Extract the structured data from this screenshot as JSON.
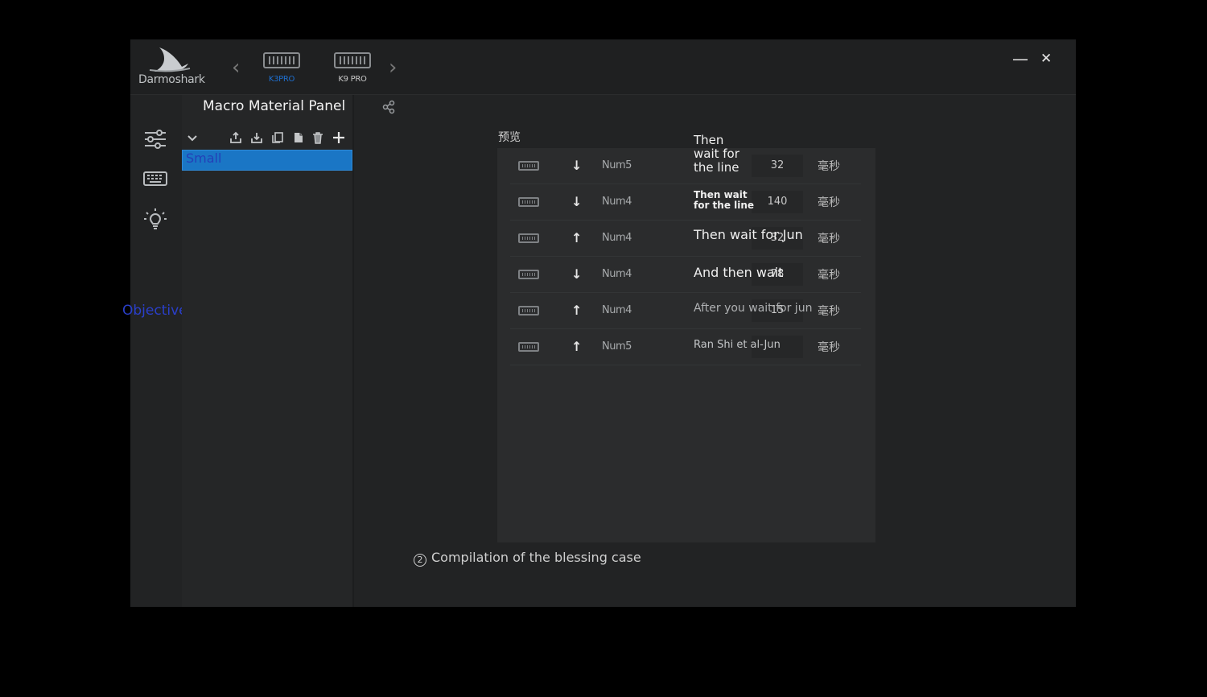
{
  "app": {
    "brand": "Darmoshark",
    "window_controls": {
      "minimize": "—",
      "close": "✕"
    },
    "devices": [
      {
        "label": "K3PRO",
        "active": true,
        "color": "#1e6fd0"
      },
      {
        "label": "K9 PRO",
        "active": false,
        "color": "#c8c8c8"
      }
    ]
  },
  "sidebar": {
    "items": [
      {
        "icon": "sliders-icon"
      },
      {
        "icon": "keyboard-icon"
      },
      {
        "icon": "lightbulb-icon"
      }
    ],
    "objective_label": "Objective"
  },
  "panel": {
    "title": "Macro Material Panel",
    "toolbar": [
      "chevron-down-icon",
      "export-icon",
      "import-icon",
      "copy-icon",
      "paste-icon",
      "delete-icon",
      "add-icon"
    ],
    "macros": [
      {
        "name": "Small",
        "selected": true
      }
    ]
  },
  "preview": {
    "label": "预览",
    "rows": [
      {
        "direction": "down",
        "key": "Num5",
        "delay": "32",
        "unit": "毫秒",
        "note": "Then\nwait for\nthe line"
      },
      {
        "direction": "down",
        "key": "Num4",
        "delay": "140",
        "unit": "毫秒",
        "note": "Then wait\nfor the line"
      },
      {
        "direction": "up",
        "key": "Num4",
        "delay": "32",
        "unit": "毫秒",
        "note": "Then wait for Jun"
      },
      {
        "direction": "down",
        "key": "Num4",
        "delay": "78",
        "unit": "毫秒",
        "note": "And then wait"
      },
      {
        "direction": "up",
        "key": "Num4",
        "delay": "15",
        "unit": "毫秒",
        "note": "After you wait for jun"
      },
      {
        "direction": "up",
        "key": "Num5",
        "delay": "",
        "unit": "毫秒",
        "note": "Ran Shi et al-Jun"
      }
    ]
  },
  "footer": {
    "text": "Compilation of the blessing case",
    "marker": "2"
  },
  "colors": {
    "accent": "#1a76c5",
    "objective": "#2a3fc9"
  }
}
